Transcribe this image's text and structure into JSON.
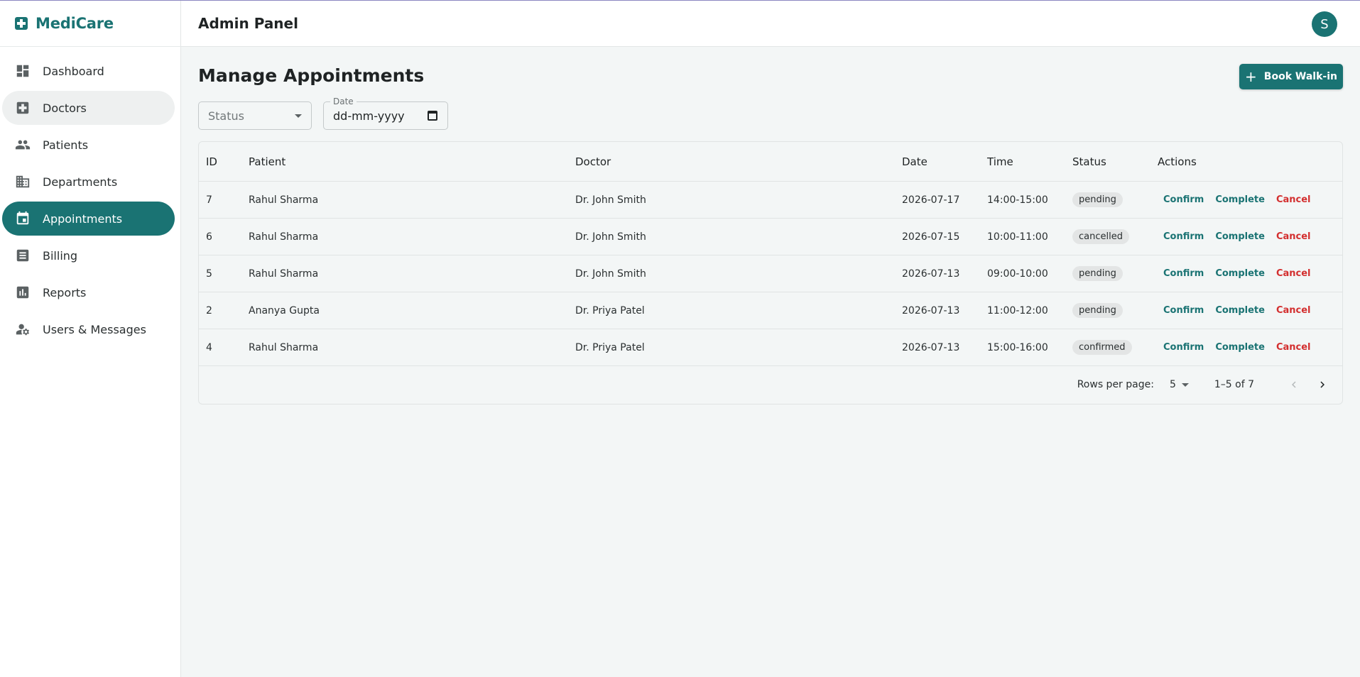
{
  "brand": {
    "name": "MediCare",
    "color": "#1a7373"
  },
  "sidebar": {
    "items": [
      {
        "label": "Dashboard",
        "icon": "dashboard-icon"
      },
      {
        "label": "Doctors",
        "icon": "medical-cross-icon",
        "state": "hover"
      },
      {
        "label": "Patients",
        "icon": "people-icon"
      },
      {
        "label": "Departments",
        "icon": "building-icon"
      },
      {
        "label": "Appointments",
        "icon": "calendar-icon",
        "state": "active"
      },
      {
        "label": "Billing",
        "icon": "receipt-icon"
      },
      {
        "label": "Reports",
        "icon": "bar-chart-icon"
      },
      {
        "label": "Users & Messages",
        "icon": "manage-accounts-icon"
      }
    ]
  },
  "header": {
    "title": "Admin Panel",
    "avatar_initial": "S"
  },
  "main": {
    "title": "Manage Appointments",
    "walkin_button": "Book Walk-in",
    "filters": {
      "status_placeholder": "Status",
      "date_label": "Date",
      "date_placeholder": "dd-mm-yyyy"
    },
    "table": {
      "columns": [
        "ID",
        "Patient",
        "Doctor",
        "Date",
        "Time",
        "Status",
        "Actions"
      ],
      "rows": [
        {
          "id": "7",
          "patient": "Rahul Sharma",
          "doctor": "Dr. John Smith",
          "date": "2026-07-17",
          "time": "14:00-15:00",
          "status": "pending"
        },
        {
          "id": "6",
          "patient": "Rahul Sharma",
          "doctor": "Dr. John Smith",
          "date": "2026-07-15",
          "time": "10:00-11:00",
          "status": "cancelled"
        },
        {
          "id": "5",
          "patient": "Rahul Sharma",
          "doctor": "Dr. John Smith",
          "date": "2026-07-13",
          "time": "09:00-10:00",
          "status": "pending"
        },
        {
          "id": "2",
          "patient": "Ananya Gupta",
          "doctor": "Dr. Priya Patel",
          "date": "2026-07-13",
          "time": "11:00-12:00",
          "status": "pending"
        },
        {
          "id": "4",
          "patient": "Rahul Sharma",
          "doctor": "Dr. Priya Patel",
          "date": "2026-07-13",
          "time": "15:00-16:00",
          "status": "confirmed"
        }
      ],
      "actions": {
        "confirm": "Confirm",
        "complete": "Complete",
        "cancel": "Cancel"
      }
    },
    "pagination": {
      "rows_per_page_label": "Rows per page:",
      "rows_per_page": "5",
      "range": "1–5 of 7"
    }
  },
  "colors": {
    "primary": "#1a7373",
    "danger": "#d32f2f",
    "background": "#f3f6f6"
  }
}
